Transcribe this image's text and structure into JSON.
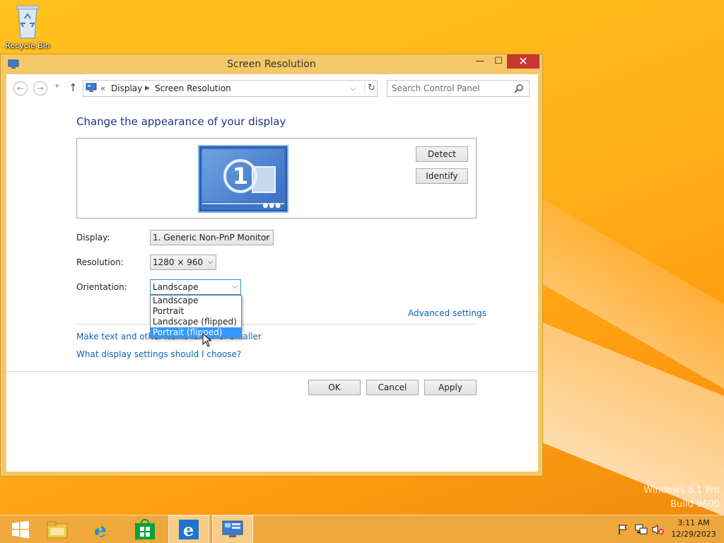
{
  "desktop": {
    "recycle_bin_label": "Recycle Bin",
    "watermark_line1": "Windows 8.1 Pro",
    "watermark_line2": "Build 9600"
  },
  "window": {
    "title": "Screen Resolution",
    "minimize_glyph": "—",
    "maximize_glyph": "☐",
    "close_glyph": "✕"
  },
  "address_bar": {
    "crumb_separator": "«",
    "breadcrumbs": [
      "Display",
      "Screen Resolution"
    ],
    "search_placeholder": "Search Control Panel"
  },
  "main": {
    "heading": "Change the appearance of your display",
    "monitor_number": "1",
    "detect_label": "Detect",
    "identify_label": "Identify",
    "display_label": "Display:",
    "display_value": "1. Generic Non-PnP Monitor",
    "resolution_label": "Resolution:",
    "resolution_value": "1280 × 960",
    "orientation_label": "Orientation:",
    "orientation_value": "Landscape",
    "orientation_options": [
      "Landscape",
      "Portrait",
      "Landscape (flipped)",
      "Portrait (flipped)"
    ],
    "orientation_highlighted_index": 3,
    "advanced_settings_link": "Advanced settings",
    "text_size_link": "Make text and other items larger or smaller",
    "which_settings_link": "What display settings should I choose?",
    "ok_label": "OK",
    "cancel_label": "Cancel",
    "apply_label": "Apply"
  },
  "taskbar": {
    "items": [
      "start",
      "file-explorer",
      "internet-explorer",
      "store",
      "internet-explorer-pinned",
      "control-panel"
    ],
    "clock_time": "3:11 AM",
    "clock_date": "12/29/2023"
  },
  "colors": {
    "accent_close": "#c7362f",
    "link": "#0d63b5",
    "heading": "#1e3287",
    "selection": "#3399ff"
  }
}
